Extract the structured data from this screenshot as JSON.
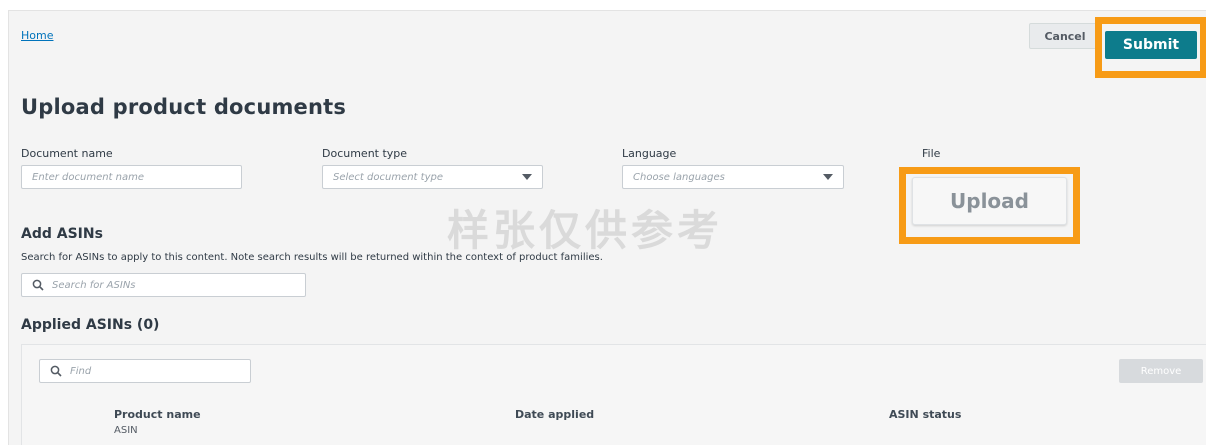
{
  "header": {
    "breadcrumb_home": "Home",
    "cancel_label": "Cancel",
    "submit_label": "Submit"
  },
  "page": {
    "title": "Upload product documents"
  },
  "form": {
    "document_name": {
      "label": "Document name",
      "placeholder": "Enter document name"
    },
    "document_type": {
      "label": "Document type",
      "placeholder": "Select document type"
    },
    "language": {
      "label": "Language",
      "placeholder": "Choose languages"
    },
    "file": {
      "label": "File",
      "upload_label": "Upload"
    }
  },
  "watermark": "样张仅供参考",
  "add_asins": {
    "heading": "Add ASINs",
    "helper": "Search for ASINs to apply to this content. Note search results will be returned within the context of product families.",
    "search_placeholder": "Search for ASINs"
  },
  "applied_asins": {
    "heading": "Applied ASINs (0)",
    "find_placeholder": "Find",
    "remove_label": "Remove",
    "columns": {
      "product_name": "Product name",
      "product_sub": "ASIN",
      "date_applied": "Date applied",
      "asin_status": "ASIN status"
    }
  },
  "colors": {
    "accent_highlight": "#f79b16",
    "submit_bg": "#0d7c8c",
    "link": "#0073bb"
  },
  "icons": {
    "search": "search-icon",
    "dropdown": "chevron-down-icon"
  }
}
